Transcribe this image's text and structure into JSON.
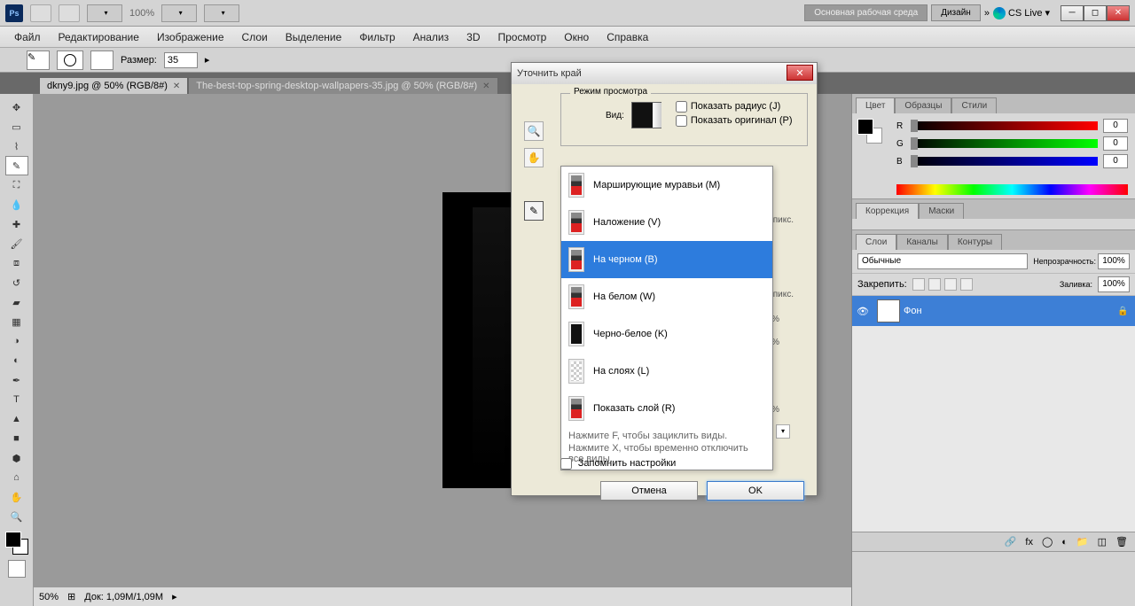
{
  "top": {
    "zoom": "100%",
    "workspace_active": "Основная рабочая среда",
    "workspace_alt": "Дизайн",
    "cs_live": "CS Live"
  },
  "menu": [
    "Файл",
    "Редактирование",
    "Изображение",
    "Слои",
    "Выделение",
    "Фильтр",
    "Анализ",
    "3D",
    "Просмотр",
    "Окно",
    "Справка"
  ],
  "options": {
    "size_label": "Размер:",
    "size_value": "35"
  },
  "tabs": {
    "t0": "dkny9.jpg @ 50% (RGB/8#)",
    "t1": "The-best-top-spring-desktop-wallpapers-35.jpg @ 50% (RGB/8#)"
  },
  "status": {
    "zoom": "50%",
    "doc": "Док: 1,09M/1,09M"
  },
  "panels": {
    "color": {
      "tabs": [
        "Цвет",
        "Образцы",
        "Стили"
      ],
      "r": "0",
      "g": "0",
      "b": "0"
    },
    "adjust": {
      "tabs": [
        "Коррекция",
        "Маски"
      ]
    },
    "layers": {
      "tabs": [
        "Слои",
        "Каналы",
        "Контуры"
      ],
      "blend": "Обычные",
      "opacity_label": "Непрозрачность:",
      "opacity": "100%",
      "lock_label": "Закрепить:",
      "fill_label": "Заливка:",
      "fill": "100%",
      "layer0": "Фон"
    }
  },
  "dialog": {
    "title": "Уточнить край",
    "group_label": "Режим просмотра",
    "view_label": "Вид:",
    "show_radius": "Показать радиус (J)",
    "show_original": "Показать оригинал (P)",
    "hidden_unit": "пикс.",
    "hidden_pct": "%",
    "items": {
      "0": "Марширующие муравьи (M)",
      "1": "Наложение (V)",
      "2": "На черном (B)",
      "3": "На белом (W)",
      "4": "Черно-белое (K)",
      "5": "На слоях (L)",
      "6": "Показать слой (R)"
    },
    "hint1": "Нажмите F, чтобы зациклить виды.",
    "hint2": "Нажмите X, чтобы временно отключить все виды.",
    "remember": "Запомнить настройки",
    "cancel": "Отмена",
    "ok": "OK"
  }
}
